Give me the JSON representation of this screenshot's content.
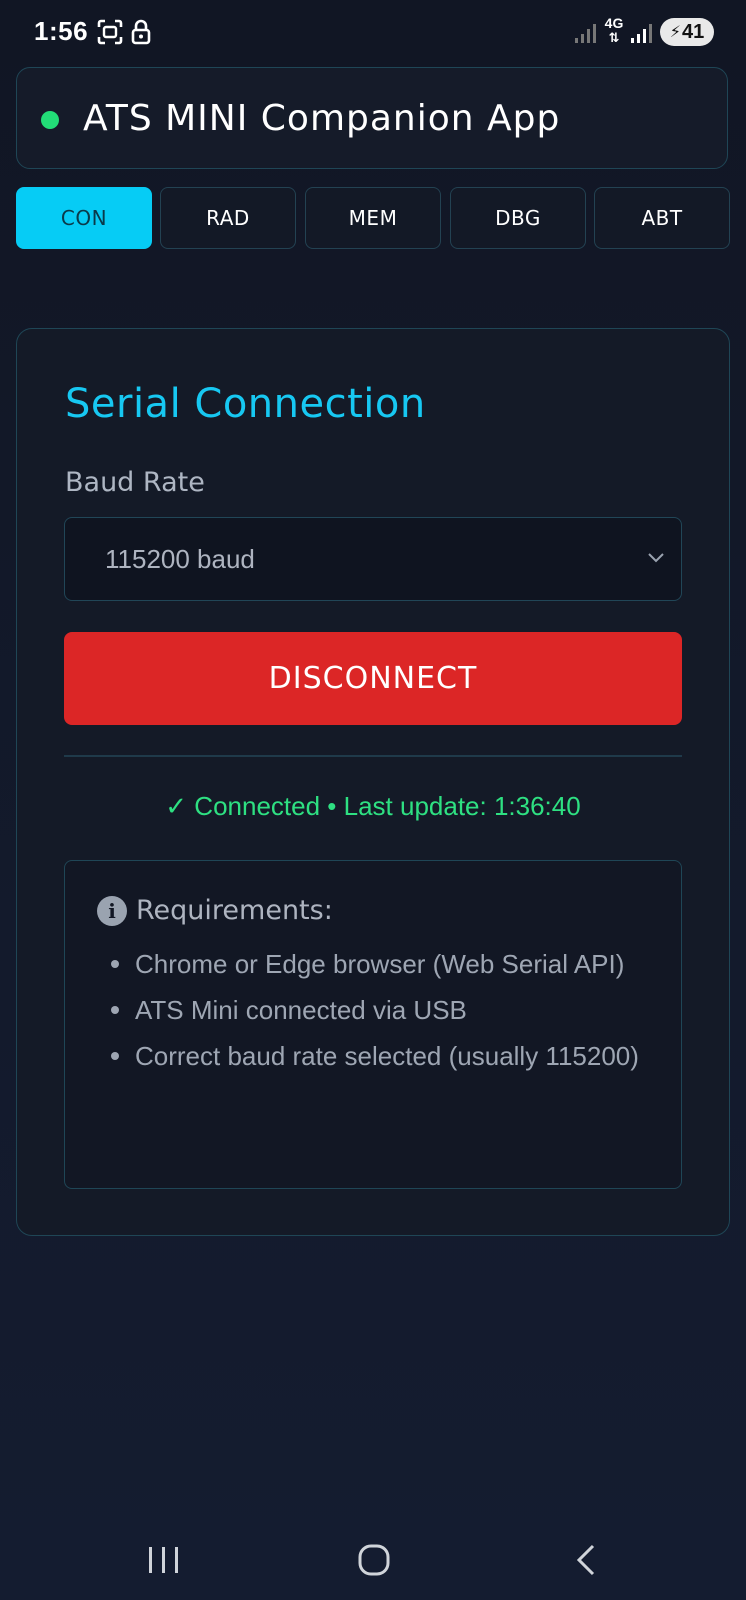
{
  "status_bar": {
    "time": "1:56",
    "network_type": "4G",
    "battery_level": "41",
    "icons": [
      "screenshot-icon",
      "lock-icon",
      "signal-icon",
      "signal-icon",
      "battery-charging-icon"
    ]
  },
  "app": {
    "title": "ATS MINI Companion App",
    "connection_indicator_color": "#22dd77"
  },
  "tabs": [
    {
      "label": "CON",
      "active": true
    },
    {
      "label": "RAD",
      "active": false
    },
    {
      "label": "MEM",
      "active": false
    },
    {
      "label": "DBG",
      "active": false
    },
    {
      "label": "ABT",
      "active": false
    }
  ],
  "serial": {
    "title": "Serial Connection",
    "baud_label": "Baud Rate",
    "baud_value": "115200 baud",
    "disconnect_label": "DISCONNECT",
    "status_text": "✓ Connected • Last update: 1:36:40"
  },
  "requirements": {
    "title": "Requirements:",
    "items": [
      "Chrome or Edge browser (Web Serial API)",
      "ATS Mini connected via USB",
      "Correct baud rate selected (usually 115200)"
    ]
  },
  "colors": {
    "accent": "#06ccf5",
    "danger": "#dc2626",
    "success": "#2ee082",
    "background": "#111624"
  },
  "nav_bar": {
    "icons": [
      "recent-apps-icon",
      "home-icon",
      "back-icon"
    ]
  }
}
